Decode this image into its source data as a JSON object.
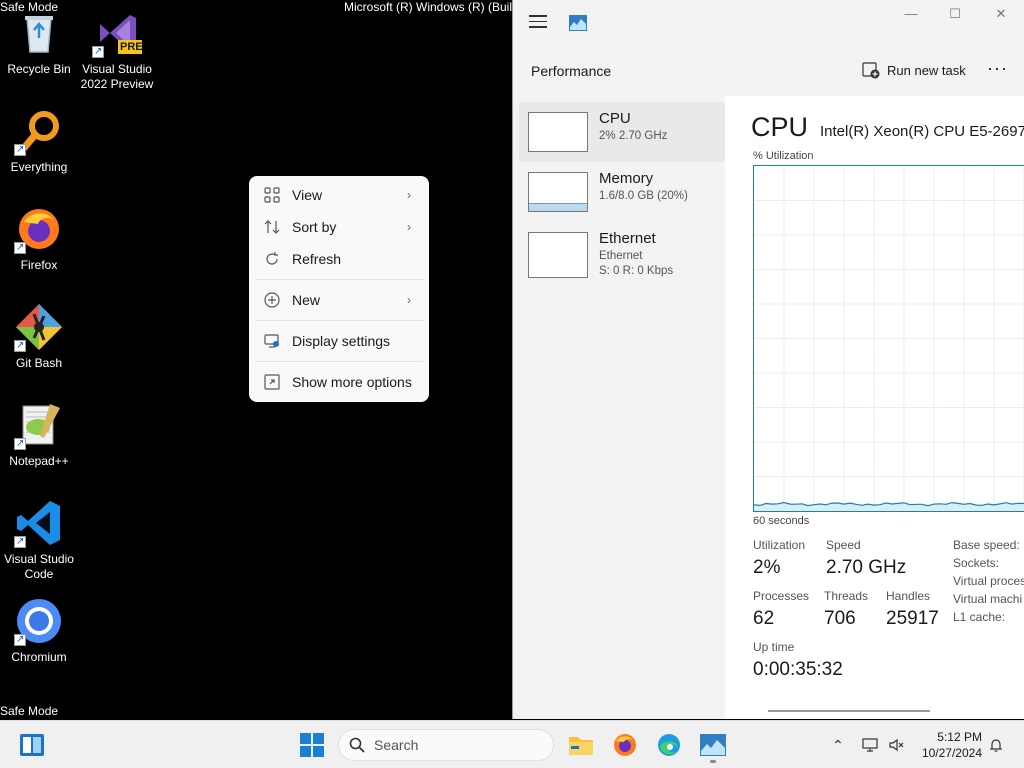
{
  "desktop": {
    "safe_mode_top": "Safe Mode",
    "safe_mode_bottom": "Safe Mode",
    "build_text": "Microsoft (R) Windows (R) (Buil",
    "icons": [
      {
        "label": "Recycle Bin",
        "icon": "recycle-bin-icon"
      },
      {
        "label": "Visual Studio 2022 Preview",
        "icon": "visual-studio-icon",
        "badge": "PRE"
      },
      {
        "label": "Everything",
        "icon": "everything-search-icon"
      },
      {
        "label": "Firefox",
        "icon": "firefox-icon"
      },
      {
        "label": "Git Bash",
        "icon": "git-bash-icon"
      },
      {
        "label": "Notepad++",
        "icon": "notepad-plus-plus-icon"
      },
      {
        "label": "Visual Studio Code",
        "icon": "vscode-icon"
      },
      {
        "label": "Chromium",
        "icon": "chromium-icon"
      }
    ]
  },
  "context_menu": {
    "items": [
      {
        "label": "View",
        "icon": "grid-view-icon",
        "submenu": true
      },
      {
        "label": "Sort by",
        "icon": "sort-icon",
        "submenu": true
      },
      {
        "label": "Refresh",
        "icon": "refresh-icon",
        "submenu": false
      },
      {
        "label": "New",
        "icon": "plus-circle-icon",
        "submenu": true
      },
      {
        "label": "Display settings",
        "icon": "display-settings-icon",
        "submenu": false
      },
      {
        "label": "Show more options",
        "icon": "show-more-options-icon",
        "submenu": false
      }
    ]
  },
  "task_manager": {
    "section_title": "Performance",
    "run_new_task": "Run new task",
    "more": "···",
    "window_controls": {
      "minimize": "—",
      "maximize": "☐",
      "close": "✕"
    },
    "side_items": [
      {
        "name": "CPU",
        "sub1": "2% 2.70 GHz",
        "sub2": ""
      },
      {
        "name": "Memory",
        "sub1": "1.6/8.0 GB (20%)",
        "sub2": ""
      },
      {
        "name": "Ethernet",
        "sub1": "Ethernet",
        "sub2": "S: 0 R: 0 Kbps"
      }
    ],
    "cpu": {
      "heading": "CPU",
      "model": "Intel(R) Xeon(R) CPU E5-2697",
      "utilization_label": "% Utilization",
      "time_label": "60 seconds",
      "utilization_percent": 2,
      "stats": {
        "utilization_label": "Utilization",
        "utilization": "2%",
        "speed_label": "Speed",
        "speed": "2.70 GHz",
        "processes_label": "Processes",
        "processes": "62",
        "threads_label": "Threads",
        "threads": "706",
        "handles_label": "Handles",
        "handles": "25917",
        "uptime_label": "Up time",
        "uptime": "0:00:35:32"
      },
      "right_labels": [
        "Base speed:",
        "Sockets:",
        "Virtual proces",
        "Virtual machi",
        "L1 cache:"
      ]
    }
  },
  "taskbar": {
    "search_placeholder": "Search",
    "time": "5:12 PM",
    "date": "10/27/2024"
  },
  "colors": {
    "graph_border": "#1782b5",
    "graph_fill": "#d9edf6",
    "memory_fill": "#bcd9ee"
  }
}
